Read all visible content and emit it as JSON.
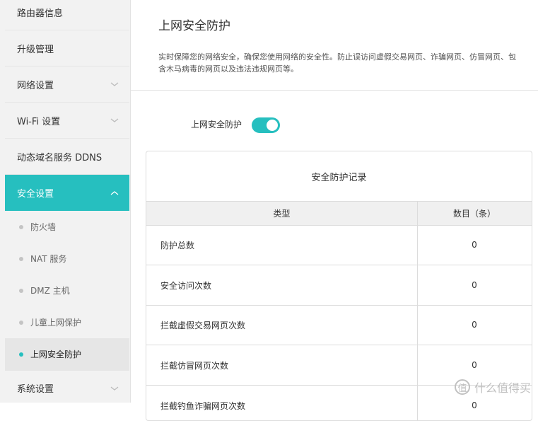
{
  "sidebar": {
    "items": [
      {
        "label": "路由器信息"
      },
      {
        "label": "升级管理"
      },
      {
        "label": "网络设置"
      },
      {
        "label": "Wi-Fi 设置"
      },
      {
        "label": "动态域名服务 DDNS"
      },
      {
        "label": "安全设置"
      }
    ],
    "sub_items": [
      {
        "label": "防火墙"
      },
      {
        "label": "NAT 服务"
      },
      {
        "label": "DMZ 主机"
      },
      {
        "label": "儿童上网保护"
      },
      {
        "label": "上网安全防护"
      }
    ],
    "bottom_item": {
      "label": "系统设置"
    },
    "accent_color": "#26bfbf"
  },
  "main": {
    "title": "上网安全防护",
    "description": "实时保障您的网络安全，确保您使用网络的安全性。防止误访问虚假交易网页、诈骗网页、仿冒网页、包含木马病毒的网页以及违法违规网页等。",
    "toggle": {
      "label": "上网安全防护",
      "on": true
    }
  },
  "records": {
    "title": "安全防护记录",
    "columns": [
      "类型",
      "数目（条）"
    ],
    "rows": [
      {
        "type": "防护总数",
        "count": "0"
      },
      {
        "type": "安全访问次数",
        "count": "0"
      },
      {
        "type": "拦截虚假交易网页次数",
        "count": "0"
      },
      {
        "type": "拦截仿冒网页次数",
        "count": "0"
      },
      {
        "type": "拦截钓鱼诈骗网页次数",
        "count": "0"
      }
    ]
  },
  "watermark": {
    "text": "什么值得买",
    "glyph": "值"
  }
}
